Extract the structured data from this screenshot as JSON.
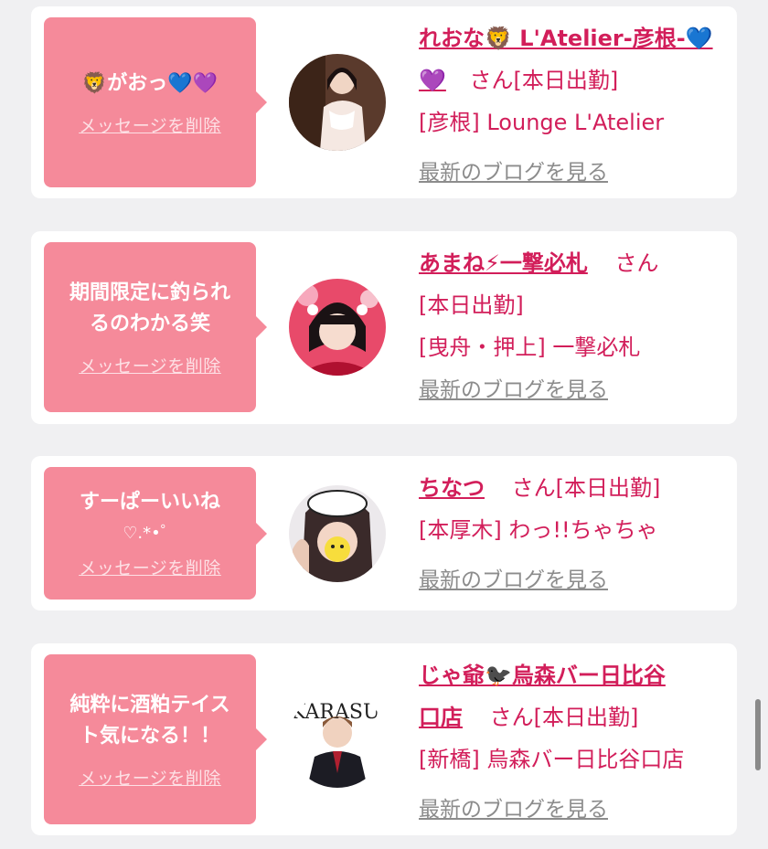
{
  "cards": [
    {
      "message": "🦁がおっ💙💜",
      "delete_label": "メッセージを削除",
      "name": "れおな🦁 L'Atelier-彦根-💙💜",
      "san": "さん",
      "status": "[本日出勤]",
      "shop": "[彦根] Lounge L'Atelier",
      "blog_label": "最新のブログを見る"
    },
    {
      "message_line1": "期間限定に釣られ",
      "message_line2": "るのわかる笑",
      "delete_label": "メッセージを削除",
      "name": "あまね⚡一撃必札",
      "san": "さん",
      "status": "[本日出勤]",
      "shop": "[曳舟・押上] 一撃必札",
      "blog_label": "最新のブログを見る"
    },
    {
      "message_line1": "すーぱーいいね",
      "message_line2": "♡.*•゜",
      "delete_label": "メッセージを削除",
      "name": "ちなつ",
      "san": "さん",
      "status": "[本日出勤]",
      "shop": "[本厚木] わっ!!ちゃちゃ",
      "blog_label": "最新のブログを見る"
    },
    {
      "message_line1": "純粋に酒粕テイス",
      "message_line2": "ト気になる！！",
      "delete_label": "メッセージを削除",
      "name_line1": "じゃ爺🐦‍⬛烏森バー日比谷",
      "name_line2": "口店",
      "san": "さん",
      "status": "[本日出勤]",
      "shop": "[新橋] 烏森バー日比谷口店",
      "blog_label": "最新のブログを見る",
      "avatar_text": "KARASU MORI BAR"
    }
  ],
  "colors": {
    "bubble": "#f58a9a",
    "accent": "#d21e5a",
    "link_gray": "#8c8c8c",
    "background": "#f0f0f2"
  }
}
